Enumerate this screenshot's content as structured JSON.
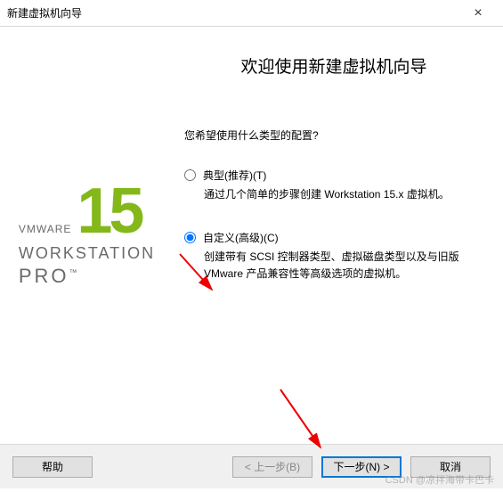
{
  "window": {
    "title": "新建虚拟机向导"
  },
  "brand": {
    "vmware": "VMWARE",
    "version": "15",
    "workstation": "WORKSTATION",
    "pro": "PRO",
    "tm": "™"
  },
  "wizard": {
    "heading": "欢迎使用新建虚拟机向导",
    "prompt": "您希望使用什么类型的配置?",
    "options": [
      {
        "label": "典型(推荐)(T)",
        "description": "通过几个简单的步骤创建 Workstation 15.x 虚拟机。",
        "selected": false
      },
      {
        "label": "自定义(高级)(C)",
        "description": "创建带有 SCSI 控制器类型、虚拟磁盘类型以及与旧版 VMware 产品兼容性等高级选项的虚拟机。",
        "selected": true
      }
    ]
  },
  "buttons": {
    "help": "帮助",
    "back": "< 上一步(B)",
    "next": "下一步(N) >",
    "cancel": "取消"
  },
  "watermark": "CSDN @凉拌海带卡巴卡"
}
